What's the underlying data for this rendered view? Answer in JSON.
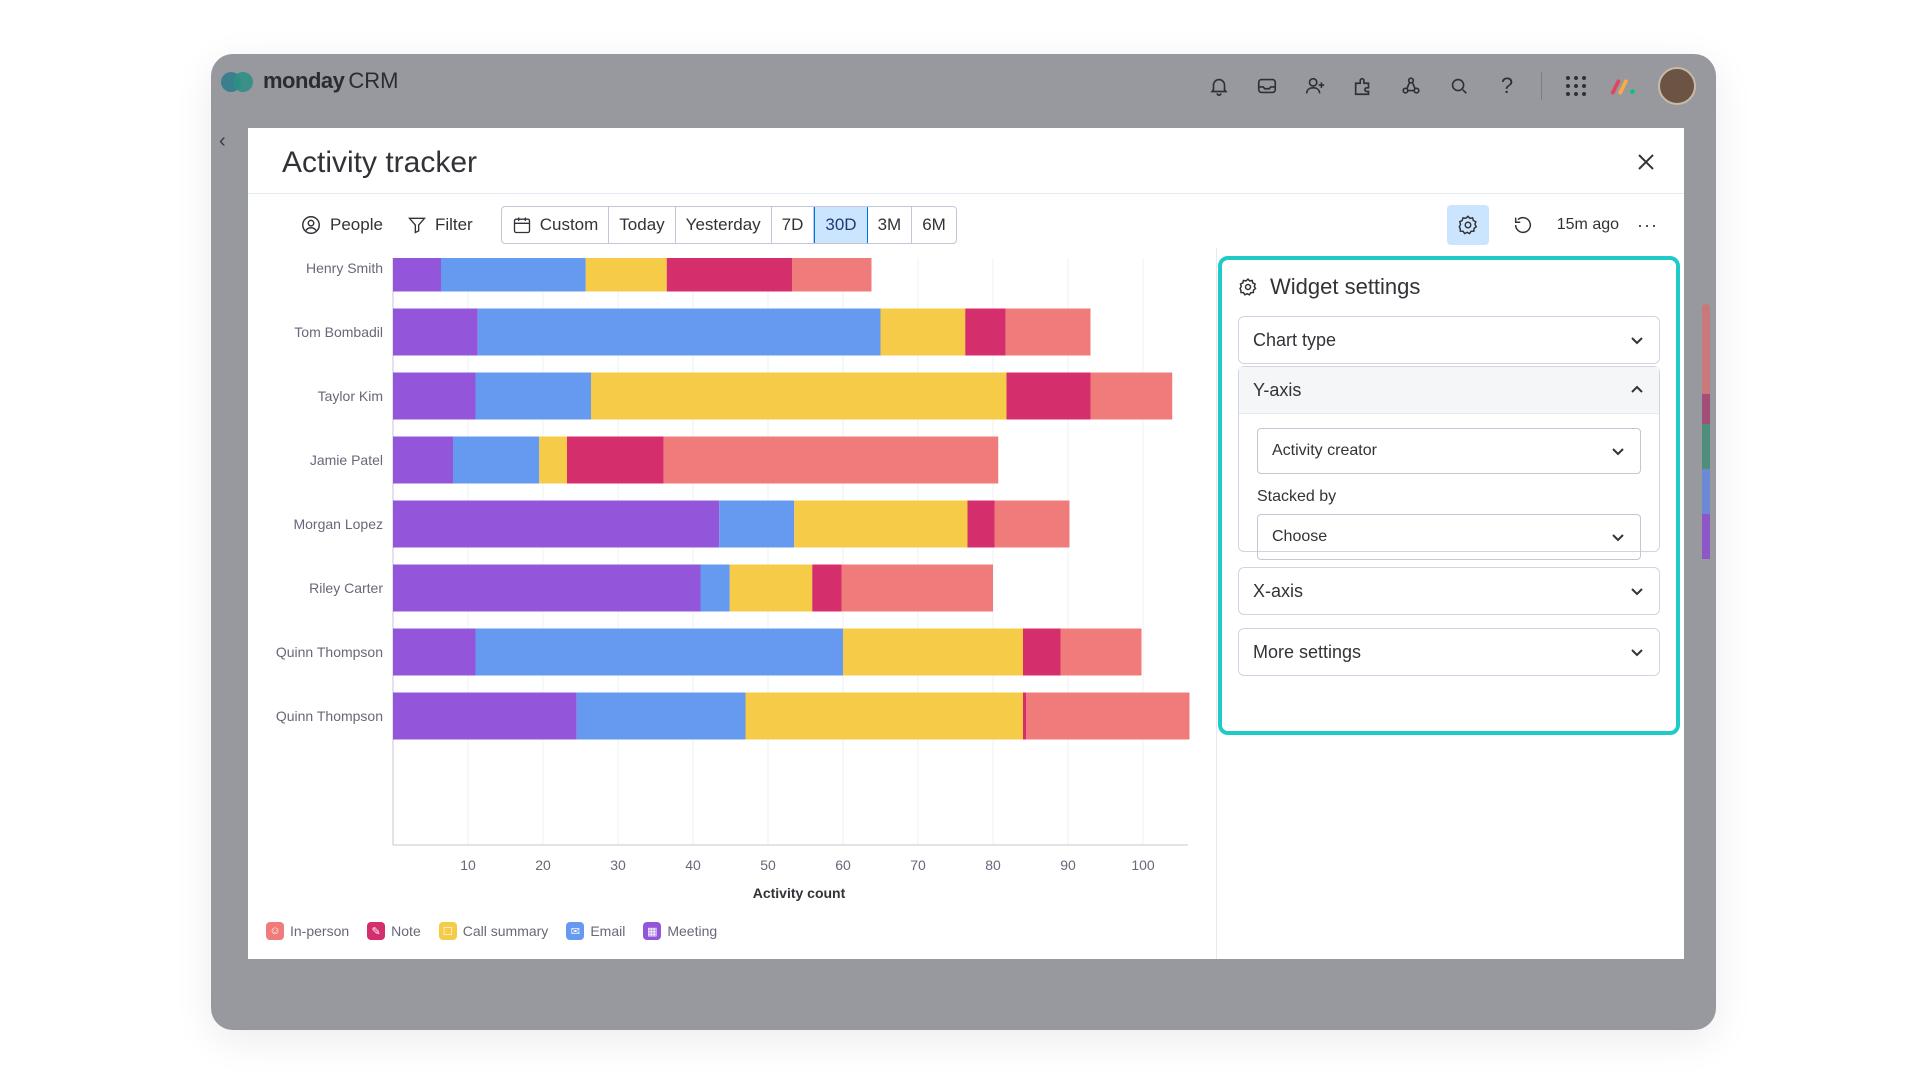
{
  "app": {
    "brand": "monday",
    "brand_sub": "CRM"
  },
  "topbar_icons": [
    "bell-icon",
    "inbox-icon",
    "invite-icon",
    "apps-icon",
    "integrations-icon",
    "search-icon",
    "help-icon",
    "grid-icon"
  ],
  "widget": {
    "title": "Activity tracker",
    "toolbar": {
      "people_label": "People",
      "filter_label": "Filter",
      "ranges": [
        "Custom",
        "Today",
        "Yesterday",
        "7D",
        "30D",
        "3M",
        "6M"
      ],
      "active_range": "30D",
      "updated": "15m ago",
      "more": "···"
    }
  },
  "settings": {
    "title": "Widget settings",
    "chart_type_label": "Chart type",
    "y_axis_label": "Y-axis",
    "y_axis_value": "Activity creator",
    "stacked_by_label": "Stacked by",
    "stacked_by_value": "Choose",
    "x_axis_label": "X-axis",
    "more_settings_label": "More settings"
  },
  "colors": {
    "Meeting": "#9356da",
    "Email": "#6699f0",
    "Call summary": "#f6cb48",
    "Note": "#d42f6c",
    "In-person": "#ef7c7a",
    "accent": "#1ecbc9"
  },
  "chart_data": {
    "type": "bar",
    "orientation": "horizontal",
    "stacked": true,
    "xlabel": "Activity count",
    "ylabel": "",
    "xlim": [
      0,
      106
    ],
    "xticks": [
      10,
      20,
      30,
      40,
      50,
      60,
      70,
      80,
      90,
      100
    ],
    "grid": true,
    "legend_position": "bottom-left",
    "categories": [
      "Henry Smith",
      "Tom Bombadil",
      "Taylor Kim",
      "Jamie Patel",
      "Morgan Lopez",
      "Riley Carter",
      "Quinn Thompson",
      "Quinn Thompson"
    ],
    "series": [
      {
        "name": "Meeting",
        "values": [
          6.4,
          11.3,
          11,
          8,
          43.5,
          41,
          11,
          24.5
        ]
      },
      {
        "name": "Email",
        "values": [
          19.3,
          53.7,
          15.4,
          11.5,
          10,
          3.9,
          49,
          22.5
        ]
      },
      {
        "name": "Call summary",
        "values": [
          10.8,
          11.3,
          55.4,
          3.7,
          23.1,
          11,
          24,
          37
        ]
      },
      {
        "name": "Note",
        "values": [
          16.7,
          5.4,
          11.2,
          12.9,
          3.6,
          3.9,
          5,
          0.4
        ]
      },
      {
        "name": "In-person",
        "values": [
          10.6,
          11.3,
          10.9,
          44.6,
          10,
          20.2,
          10.8,
          21.8
        ]
      }
    ],
    "legend": [
      {
        "name": "In-person",
        "icon": "person-icon"
      },
      {
        "name": "Note",
        "icon": "pencil-icon"
      },
      {
        "name": "Call summary",
        "icon": "call-icon"
      },
      {
        "name": "Email",
        "icon": "email-icon"
      },
      {
        "name": "Meeting",
        "icon": "calendar-icon"
      }
    ]
  }
}
